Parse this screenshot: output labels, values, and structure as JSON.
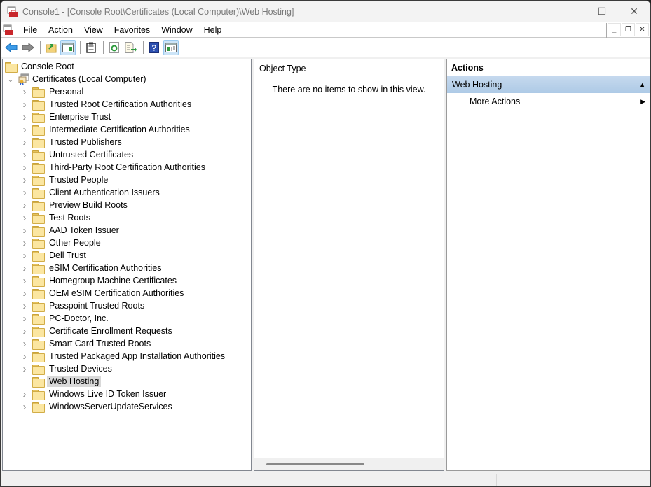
{
  "window": {
    "title": "Console1 - [Console Root\\Certificates (Local Computer)\\Web Hosting]",
    "controls": {
      "minimize": "—",
      "maximize": "☐",
      "close": "✕"
    }
  },
  "menubar": {
    "items": [
      "File",
      "Action",
      "View",
      "Favorites",
      "Window",
      "Help"
    ],
    "mdi": {
      "minimize": "_",
      "restore": "❐",
      "close": "✕"
    }
  },
  "toolbar": {
    "buttons": [
      {
        "name": "back-icon",
        "glyph": "⬅",
        "color": "#1e8fe1"
      },
      {
        "name": "forward-icon",
        "glyph": "➡",
        "color": "#7a7a7a"
      },
      {
        "name": "up-one-level-icon",
        "glyph": "📁",
        "color": "#d9a520"
      },
      {
        "name": "show-hide-console-tree-icon",
        "glyph": "▣",
        "color": "#2a7ab0",
        "active": true
      },
      {
        "name": "properties-icon",
        "glyph": "📋",
        "color": "#333333"
      },
      {
        "name": "refresh-icon",
        "glyph": "↻",
        "color": "#3aa845"
      },
      {
        "name": "export-list-icon",
        "glyph": "⇨",
        "color": "#3aa845"
      },
      {
        "name": "help-icon",
        "glyph": "?",
        "color": "#ffffff"
      },
      {
        "name": "show-hide-action-pane-icon",
        "glyph": "▣",
        "color": "#2a7ab0",
        "active": true
      }
    ]
  },
  "tree": {
    "root": "Console Root",
    "snapin": "Certificates (Local Computer)",
    "items": [
      {
        "label": "Personal",
        "expandable": true
      },
      {
        "label": "Trusted Root Certification Authorities",
        "expandable": true
      },
      {
        "label": "Enterprise Trust",
        "expandable": true
      },
      {
        "label": "Intermediate Certification Authorities",
        "expandable": true
      },
      {
        "label": "Trusted Publishers",
        "expandable": true
      },
      {
        "label": "Untrusted Certificates",
        "expandable": true
      },
      {
        "label": "Third-Party Root Certification Authorities",
        "expandable": true
      },
      {
        "label": "Trusted People",
        "expandable": true
      },
      {
        "label": "Client Authentication Issuers",
        "expandable": true
      },
      {
        "label": "Preview Build Roots",
        "expandable": true
      },
      {
        "label": "Test Roots",
        "expandable": true
      },
      {
        "label": "AAD Token Issuer",
        "expandable": true
      },
      {
        "label": "Other People",
        "expandable": true
      },
      {
        "label": "Dell Trust",
        "expandable": true
      },
      {
        "label": "eSIM Certification Authorities",
        "expandable": true
      },
      {
        "label": "Homegroup Machine Certificates",
        "expandable": true
      },
      {
        "label": "OEM eSIM Certification Authorities",
        "expandable": true
      },
      {
        "label": "Passpoint Trusted Roots",
        "expandable": true
      },
      {
        "label": "PC-Doctor, Inc.",
        "expandable": true
      },
      {
        "label": "Certificate Enrollment Requests",
        "expandable": true
      },
      {
        "label": "Smart Card Trusted Roots",
        "expandable": true
      },
      {
        "label": "Trusted Packaged App Installation Authorities",
        "expandable": true
      },
      {
        "label": "Trusted Devices",
        "expandable": true
      },
      {
        "label": "Web Hosting",
        "expandable": false,
        "selected": true
      },
      {
        "label": "Windows Live ID Token Issuer",
        "expandable": true
      },
      {
        "label": "WindowsServerUpdateServices",
        "expandable": true
      }
    ]
  },
  "center": {
    "column_header": "Object Type",
    "empty_message": "There are no items to show in this view."
  },
  "actions": {
    "title": "Actions",
    "section": "Web Hosting",
    "items": [
      {
        "label": "More Actions"
      }
    ]
  },
  "colors": {
    "selected_bg": "#d9d9d9",
    "actions_header": "#b8d1ea"
  }
}
